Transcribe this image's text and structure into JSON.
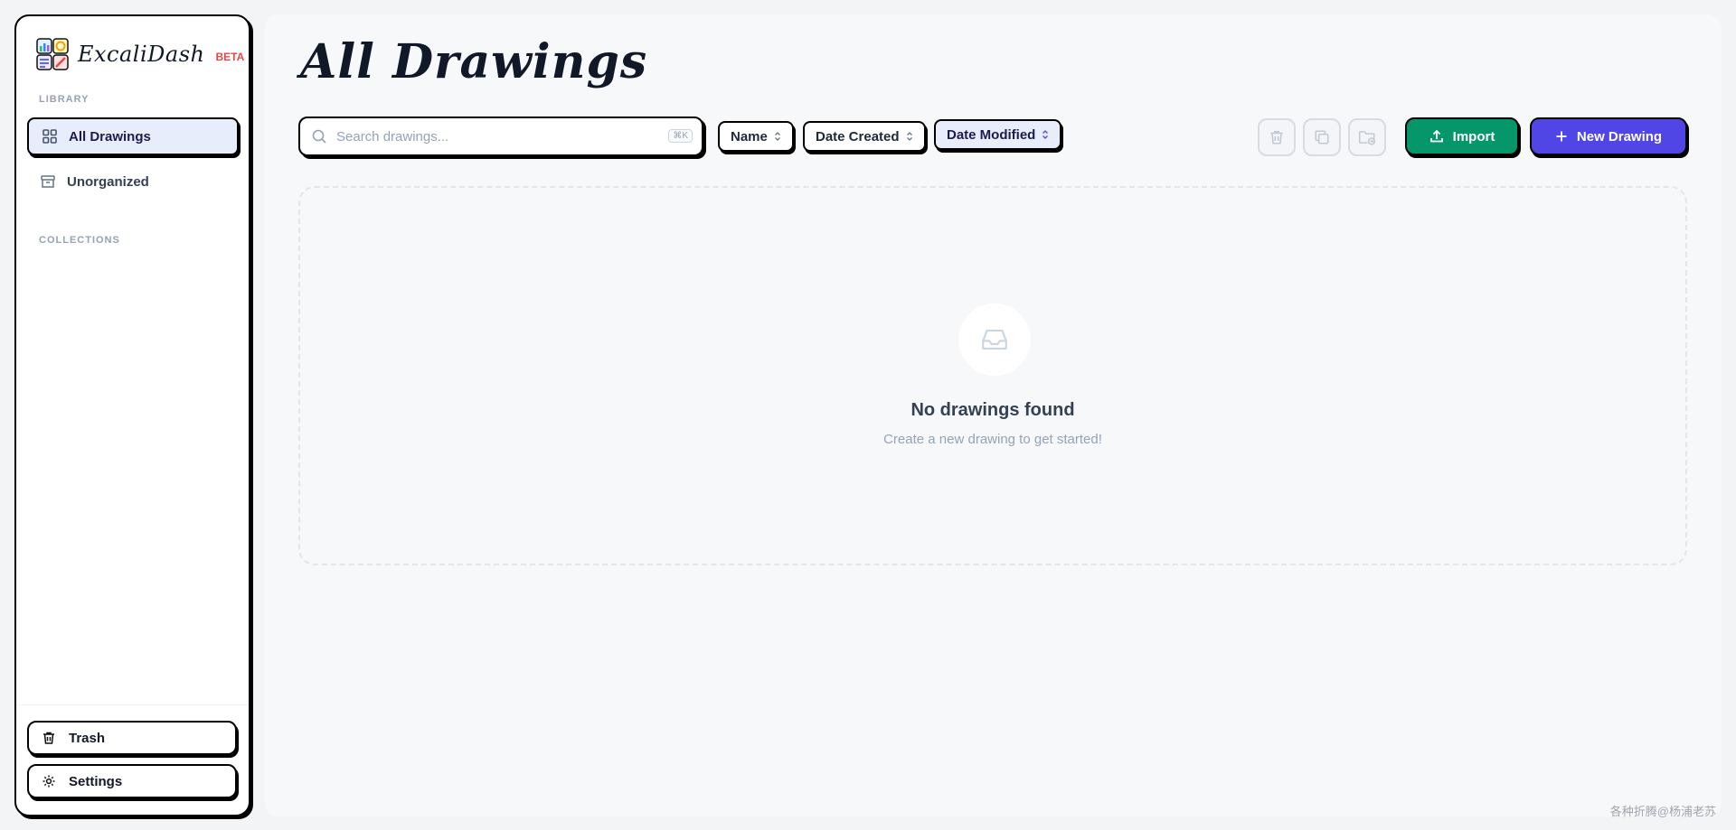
{
  "sidebar": {
    "brand": {
      "name": "ExcaliDash",
      "badge": "BETA"
    },
    "library_label": "LIBRARY",
    "items": [
      {
        "label": "All Drawings",
        "icon": "grid-icon",
        "active": true
      },
      {
        "label": "Unorganized",
        "icon": "archive-icon",
        "active": false
      }
    ],
    "collections_label": "COLLECTIONS",
    "trash_label": "Trash",
    "settings_label": "Settings"
  },
  "main": {
    "title": "All Drawings",
    "search": {
      "placeholder": "Search drawings...",
      "value": "",
      "shortcut": "⌘K"
    },
    "sort": [
      {
        "label": "Name",
        "active": false
      },
      {
        "label": "Date Created",
        "active": false
      },
      {
        "label": "Date Modified",
        "active": true
      }
    ],
    "import_label": "Import",
    "new_label": "New Drawing",
    "empty": {
      "title": "No drawings found",
      "subtitle": "Create a new drawing to get started!"
    }
  },
  "watermark": "各种折腾@杨浦老苏",
  "colors": {
    "accent": "#4f46e5",
    "import": "#059669",
    "beta": "#ef4444",
    "active_bg": "#e8edfc"
  }
}
